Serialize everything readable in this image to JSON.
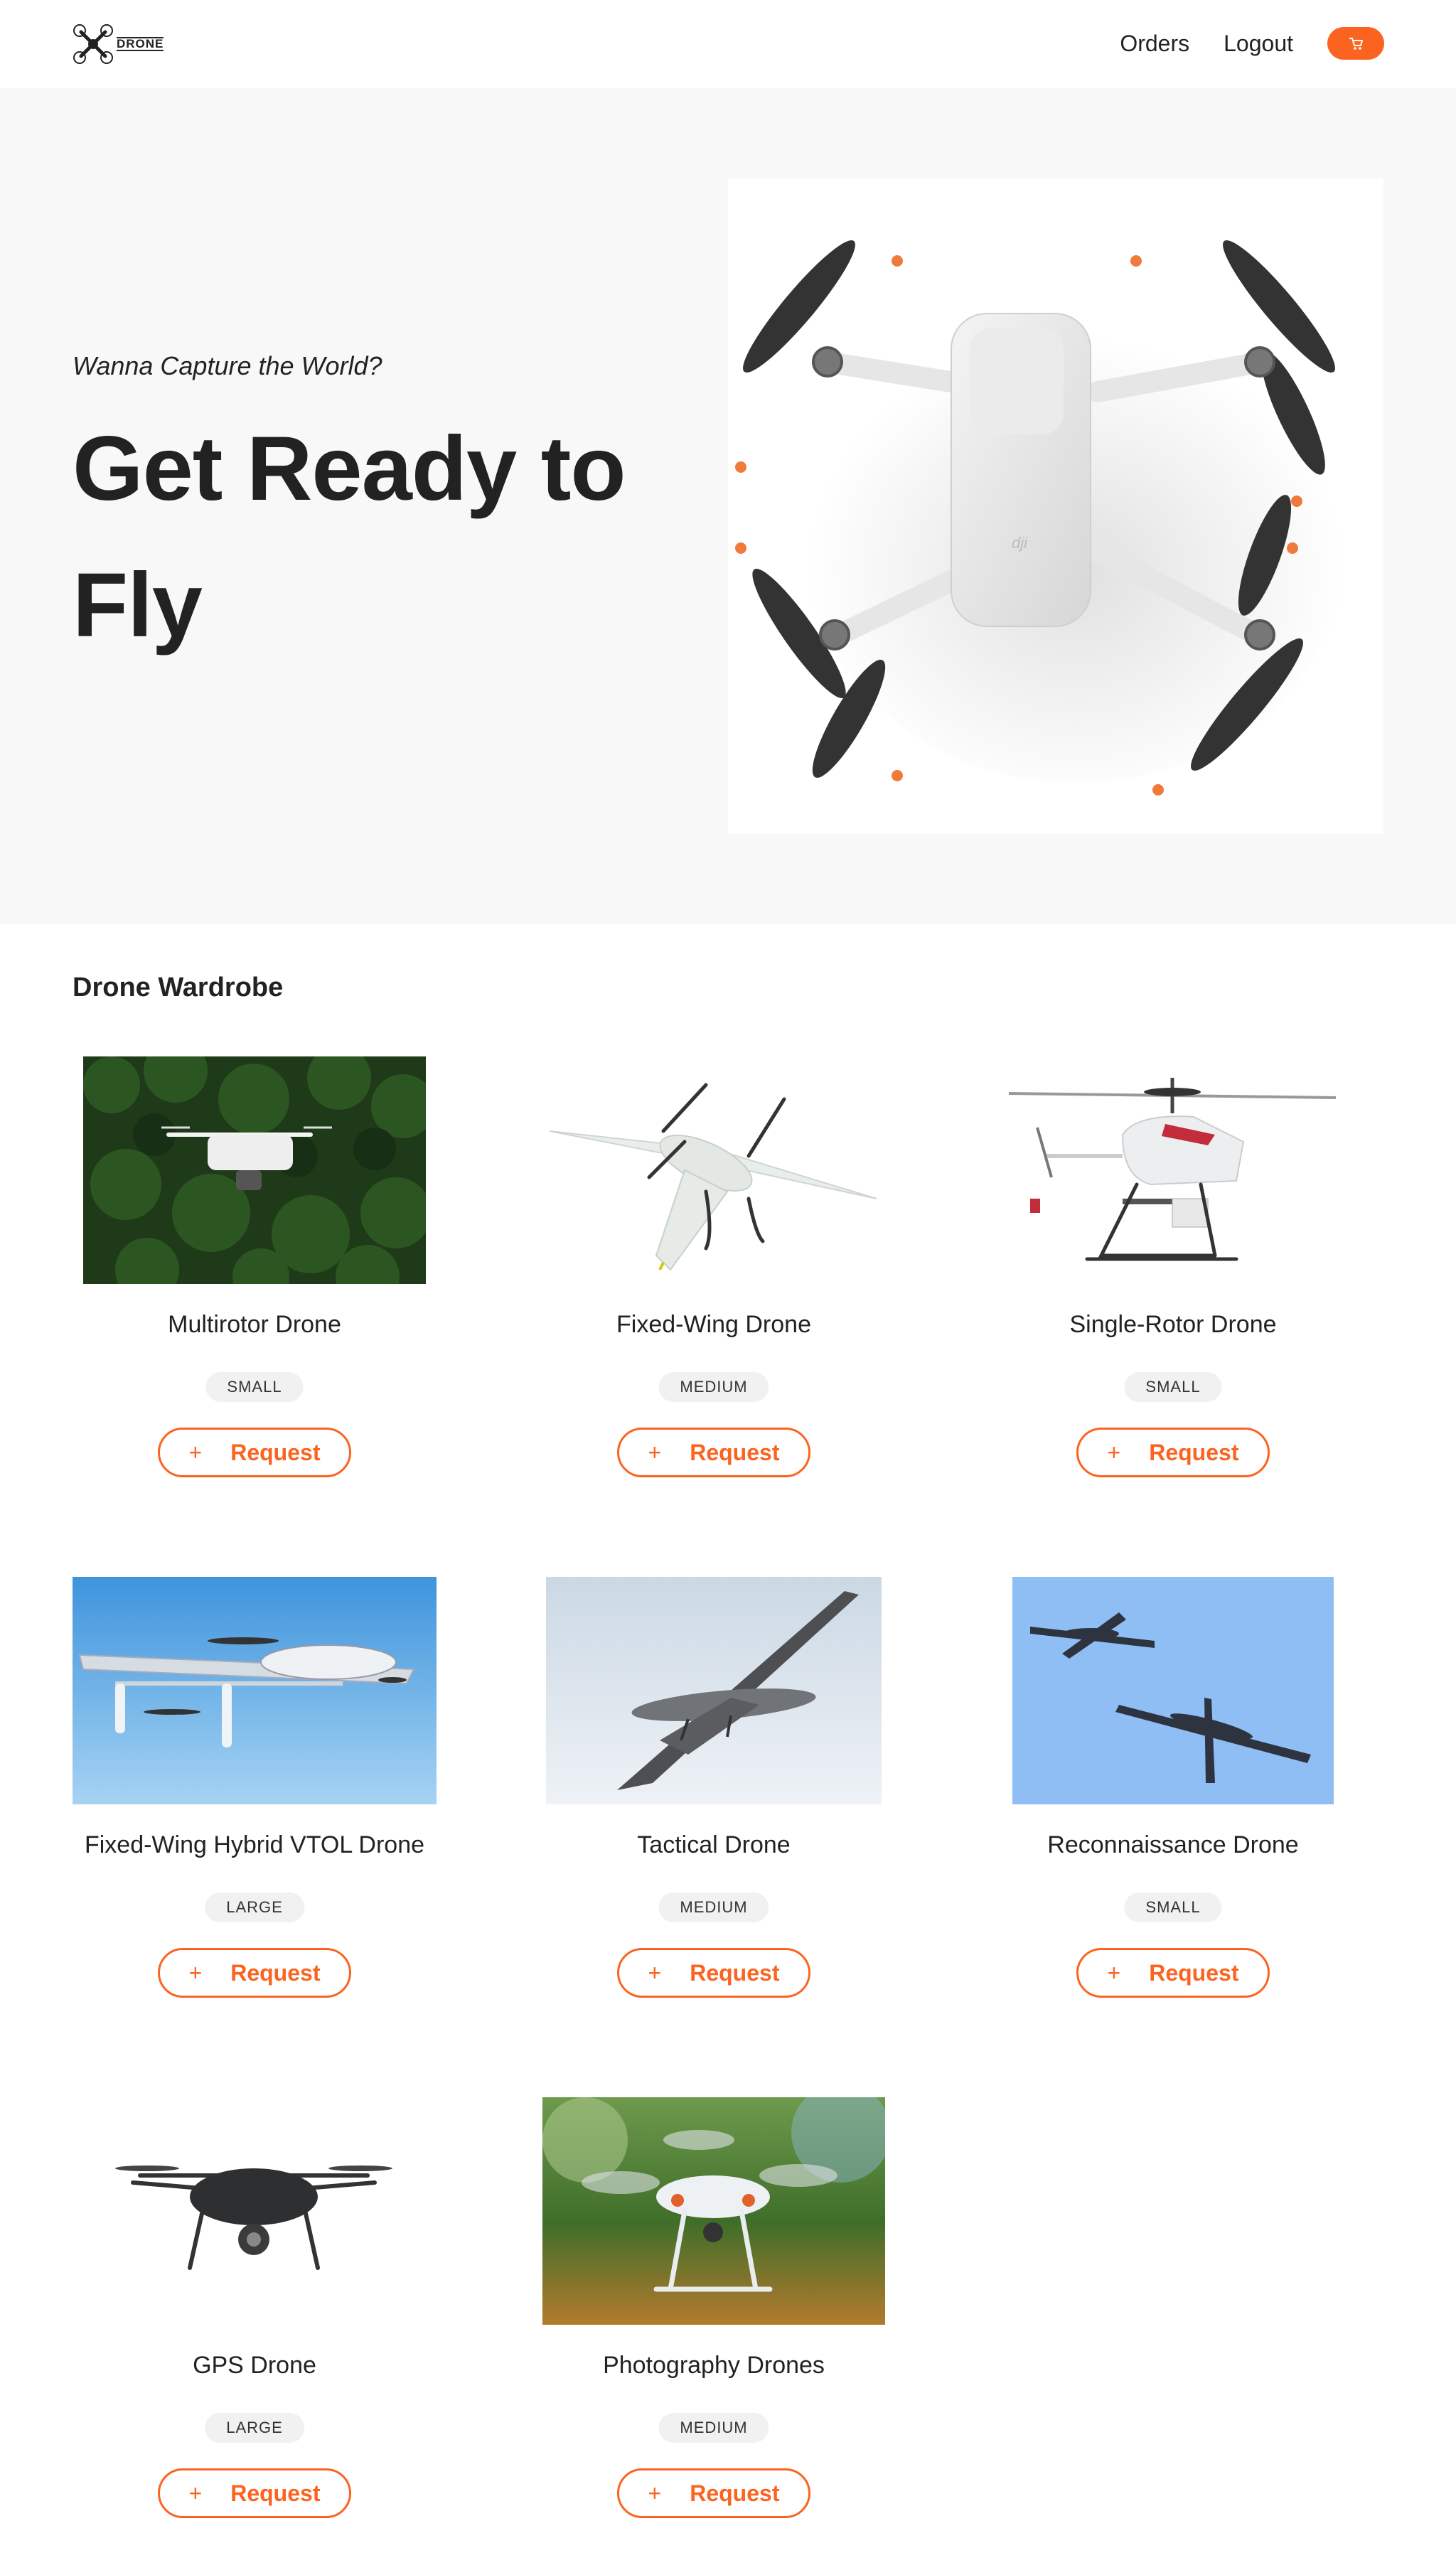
{
  "header": {
    "logo_text": "DRONE",
    "nav": {
      "orders": "Orders",
      "logout": "Logout"
    },
    "cart_icon": "cart-icon"
  },
  "hero": {
    "tagline": "Wanna Capture the World?",
    "title": "Get Ready to Fly",
    "image": "drone-top-view"
  },
  "wardrobe": {
    "title": "Drone Wardrobe",
    "items": [
      {
        "name": "Multirotor Drone",
        "size": "SMALL",
        "button": "Request",
        "image": "quadcopter-forest"
      },
      {
        "name": "Fixed-Wing Drone",
        "size": "MEDIUM",
        "button": "Request",
        "image": "fixed-wing-white"
      },
      {
        "name": "Single-Rotor Drone",
        "size": "SMALL",
        "button": "Request",
        "image": "helicopter-drone"
      },
      {
        "name": "Fixed-Wing Hybrid VTOL Drone",
        "size": "LARGE",
        "button": "Request",
        "image": "vtol-sky"
      },
      {
        "name": "Tactical Drone",
        "size": "MEDIUM",
        "button": "Request",
        "image": "tactical-sky"
      },
      {
        "name": "Reconnaissance Drone",
        "size": "SMALL",
        "button": "Request",
        "image": "recon-sky"
      },
      {
        "name": "GPS Drone",
        "size": "LARGE",
        "button": "Request",
        "image": "black-quadcopter"
      },
      {
        "name": "Photography Drones",
        "size": "MEDIUM",
        "button": "Request",
        "image": "photo-drone-blur"
      }
    ]
  },
  "colors": {
    "accent": "#fb6420",
    "hero_bg": "#f8f8f8",
    "text": "#222222",
    "badge_bg": "#f1f1f1"
  }
}
